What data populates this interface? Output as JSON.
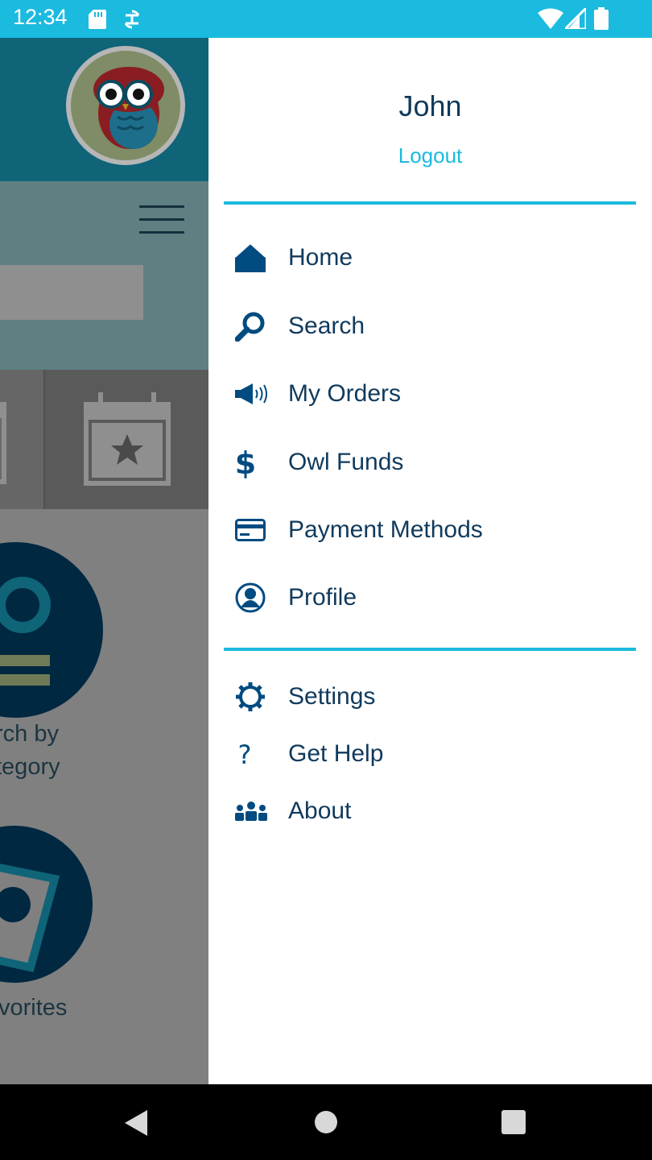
{
  "status_bar": {
    "time": "12:34",
    "icons": [
      "sd-card-icon",
      "sync-icon",
      "wifi-icon",
      "signal-icon",
      "battery-icon"
    ],
    "background_color": "#1bbadf"
  },
  "background_app": {
    "category_text": "rch by\ntegory",
    "favorites_text": "vorites"
  },
  "drawer": {
    "user_name": "John",
    "logout_label": "Logout",
    "primary_items": [
      {
        "label": "Home",
        "icon": "home-icon"
      },
      {
        "label": "Search",
        "icon": "search-icon"
      },
      {
        "label": "My Orders",
        "icon": "megaphone-icon"
      },
      {
        "label": "Owl Funds",
        "icon": "dollar-icon"
      },
      {
        "label": "Payment Methods",
        "icon": "credit-card-icon"
      },
      {
        "label": "Profile",
        "icon": "user-circle-icon"
      }
    ],
    "secondary_items": [
      {
        "label": "Settings",
        "icon": "gear-icon"
      },
      {
        "label": "Get Help",
        "icon": "question-icon"
      },
      {
        "label": "About",
        "icon": "group-icon"
      }
    ],
    "accent_color": "#1bbadf",
    "text_color": "#103a5c"
  },
  "nav_bar": {
    "buttons": [
      "back-button",
      "home-button",
      "recents-button"
    ]
  }
}
